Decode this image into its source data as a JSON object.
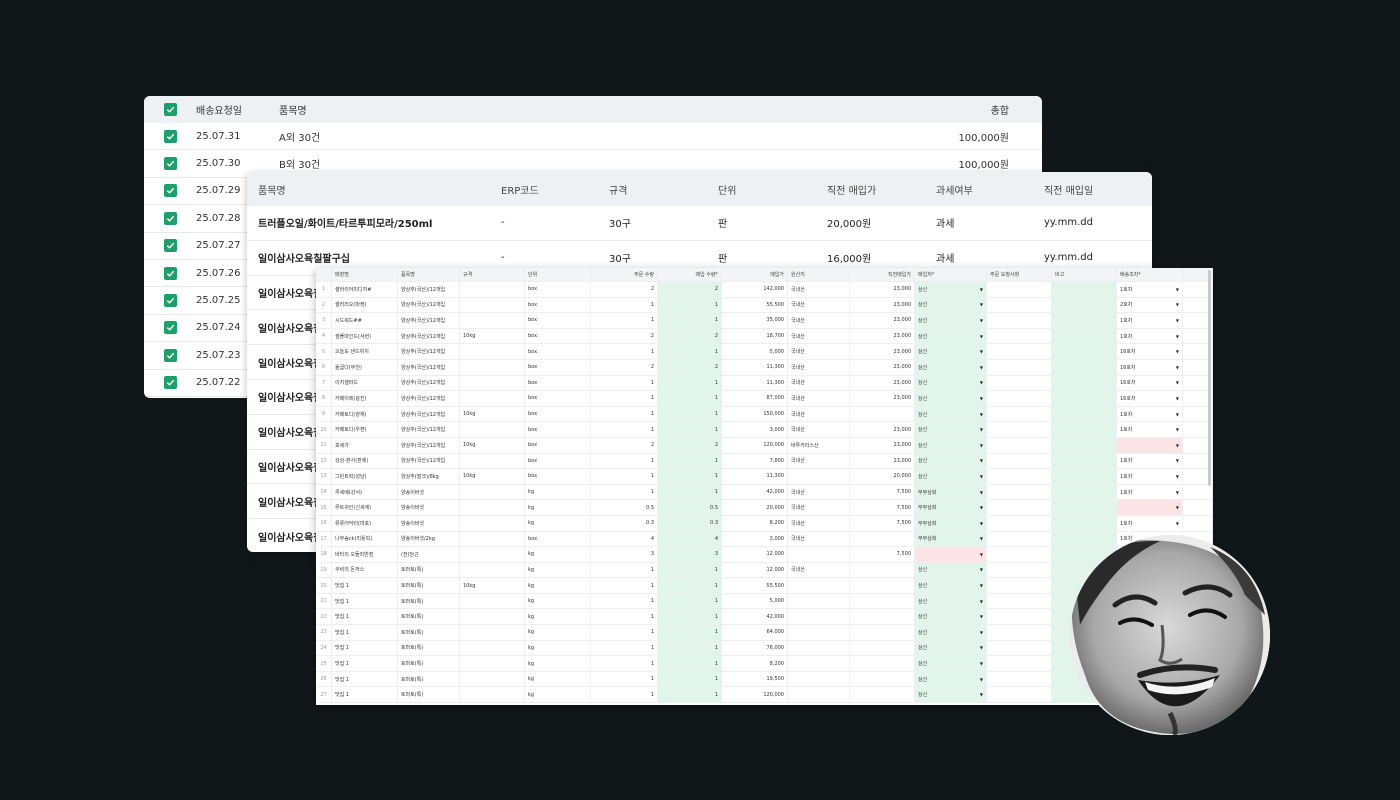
{
  "delivery_list": {
    "headers": {
      "date": "배송요청일",
      "name": "품목명",
      "total": "총합"
    },
    "rows": [
      {
        "date": "25.07.31",
        "name": "A외 30건",
        "total": "100,000원"
      },
      {
        "date": "25.07.30",
        "name": "B외 30건",
        "total": "100,000원"
      },
      {
        "date": "25.07.29",
        "name": "",
        "total": ""
      },
      {
        "date": "25.07.28",
        "name": "",
        "total": ""
      },
      {
        "date": "25.07.27",
        "name": "",
        "total": ""
      },
      {
        "date": "25.07.26",
        "name": "",
        "total": ""
      },
      {
        "date": "25.07.25",
        "name": "",
        "total": ""
      },
      {
        "date": "25.07.24",
        "name": "",
        "total": ""
      },
      {
        "date": "25.07.23",
        "name": "",
        "total": ""
      },
      {
        "date": "25.07.22",
        "name": "",
        "total": ""
      }
    ]
  },
  "item_master": {
    "headers": {
      "name": "품목명",
      "erp": "ERP코드",
      "spec": "규격",
      "unit": "단위",
      "price": "직전 매입가",
      "tax": "과세여부",
      "date": "직전 매입일"
    },
    "rows": [
      {
        "name": "트러플오일/화이트/타르투피모라/250ml",
        "erp": "-",
        "spec": "30구",
        "unit": "판",
        "price": "20,000원",
        "tax": "과세",
        "date": "yy.mm.dd"
      },
      {
        "name": "일이삼사오육칠팔구십",
        "erp": "-",
        "spec": "30구",
        "unit": "판",
        "price": "16,000원",
        "tax": "과세",
        "date": "yy.mm.dd"
      },
      {
        "name": "일이삼사오육칠팔구십",
        "erp": "",
        "spec": "",
        "unit": "",
        "price": "",
        "tax": "",
        "date": ""
      },
      {
        "name": "일이삼사오육칠팔구십",
        "erp": "",
        "spec": "",
        "unit": "",
        "price": "",
        "tax": "",
        "date": ""
      },
      {
        "name": "일이삼사오육칠팔구십",
        "erp": "",
        "spec": "",
        "unit": "",
        "price": "",
        "tax": "",
        "date": ""
      },
      {
        "name": "일이삼사오육칠팔구십",
        "erp": "",
        "spec": "",
        "unit": "",
        "price": "",
        "tax": "",
        "date": ""
      },
      {
        "name": "일이삼사오육칠팔구십",
        "erp": "",
        "spec": "",
        "unit": "",
        "price": "",
        "tax": "",
        "date": ""
      },
      {
        "name": "일이삼사오육칠팔구십",
        "erp": "",
        "spec": "",
        "unit": "",
        "price": "",
        "tax": "",
        "date": ""
      },
      {
        "name": "일이삼사오육칠팔구십",
        "erp": "",
        "spec": "",
        "unit": "",
        "price": "",
        "tax": "",
        "date": ""
      },
      {
        "name": "일이삼사오육칠팔구십",
        "erp": "",
        "spec": "",
        "unit": "",
        "price": "",
        "tax": "",
        "date": ""
      }
    ]
  },
  "order_grid": {
    "headers": [
      "",
      "매장명",
      "품목명",
      "규격",
      "단위",
      "주문 수량",
      "매입 수량*",
      "매입가",
      "원산지",
      "직전매입가",
      "매입처*",
      "주문 요청사항",
      "비고",
      "배송조차*"
    ],
    "rows": [
      [
        "1",
        "셀러리어미디지#",
        "양상추(국산)/12개입",
        "",
        "box",
        "2",
        "2",
        "142,000",
        "국내산",
        "23,000",
        "상신",
        "",
        "",
        "1호차"
      ],
      [
        "2",
        "셀러리오(마켓)",
        "양상추(국산)/12개입",
        "",
        "box",
        "1",
        "1",
        "55,500",
        "국내산",
        "23,000",
        "상신",
        "",
        "",
        "2호차"
      ],
      [
        "3",
        "시드워드##",
        "양상추(국산)/12개입",
        "",
        "box",
        "1",
        "1",
        "35,000",
        "국내산",
        "23,000",
        "상신",
        "",
        "",
        "1호차"
      ],
      [
        "4",
        "샘플마인드(서현)",
        "양상추(국산)/12개입",
        "10kg",
        "box",
        "2",
        "2",
        "18,700",
        "국내산",
        "23,000",
        "상신",
        "",
        "",
        "1호차"
      ],
      [
        "5",
        "오늘도 샌드위치",
        "양상추(국산)/12개입",
        "",
        "box",
        "1",
        "1",
        "5,000",
        "국내산",
        "23,000",
        "상신",
        "",
        "",
        "16호차"
      ],
      [
        "6",
        "울굽다(부천)",
        "양상추(국산)/12개입",
        "",
        "box",
        "2",
        "2",
        "11,300",
        "국내산",
        "23,000",
        "상신",
        "",
        "",
        "16호차"
      ],
      [
        "7",
        "이지샐러드",
        "양상추(국산)/12개입",
        "",
        "box",
        "1",
        "1",
        "11,300",
        "국내산",
        "23,000",
        "상신",
        "",
        "",
        "16호차"
      ],
      [
        "8",
        "카페이레(광진)",
        "양상추(국산)/12개입",
        "",
        "box",
        "1",
        "1",
        "87,000",
        "국내산",
        "23,000",
        "상신",
        "",
        "",
        "16호차"
      ],
      [
        "9",
        "카페토디(양재)",
        "양상추(국산)/12개입",
        "10kg",
        "box",
        "1",
        "1",
        "150,000",
        "국내산",
        "",
        "상신",
        "",
        "",
        "1호차"
      ],
      [
        "10",
        "카페토디(우편)",
        "양상추(국산)/12개입",
        "",
        "box",
        "1",
        "1",
        "3,000",
        "국내산",
        "23,000",
        "상신",
        "",
        "",
        "1호차"
      ],
      [
        "11",
        "포세가",
        "양상추(국산)/12개입",
        "10kg",
        "box",
        "2",
        "2",
        "120,000",
        "바투카라스산",
        "23,000",
        "상신",
        "",
        "",
        ""
      ],
      [
        "12",
        "성심-본사(판제)",
        "양상추(국산)/12개입",
        "",
        "box",
        "1",
        "1",
        "7,800",
        "국내산",
        "23,000",
        "상신",
        "",
        "",
        "1호차"
      ],
      [
        "13",
        "그린트럭(성남)",
        "양상추(벌크)/8kg",
        "10kg",
        "box",
        "1",
        "1",
        "11,300",
        "",
        "20,000",
        "상신",
        "",
        "",
        "1호차"
      ],
      [
        "14",
        "루세베(강서)",
        "양송이버섯",
        "",
        "kg",
        "1",
        "1",
        "42,000",
        "국내산",
        "7,500",
        "무무상회",
        "",
        "",
        "1호차"
      ],
      [
        "15",
        "루트귀인(신세계)",
        "양송이버섯",
        "",
        "kg",
        "0.5",
        "0.5",
        "20,000",
        "국내산",
        "7,500",
        "무무상회",
        "",
        "",
        ""
      ],
      [
        "16",
        "류류어딕터(마포)",
        "양송이버섯",
        "",
        "kg",
        "0.3",
        "0.3",
        "8,200",
        "국내산",
        "7,500",
        "무무상회",
        "",
        "",
        "1호차"
      ],
      [
        "17",
        "나무숲ck(리틀빅)",
        "양송이버섯/2kg",
        "",
        "box",
        "4",
        "4",
        "3,000",
        "국내산",
        "",
        "무무상회",
        "",
        "",
        "1호차"
      ],
      [
        "18",
        "바타의 오들러반점",
        "(전)당근",
        "",
        "kg",
        "3",
        "3",
        "12,000",
        "",
        "7,500",
        "",
        "",
        "",
        ""
      ],
      [
        "19",
        "쿠비의 돈까스",
        "토마토(특)",
        "",
        "kg",
        "1",
        "1",
        "12,000",
        "국내산",
        "",
        "상신",
        "",
        "",
        ""
      ],
      [
        "20",
        "맛집 1",
        "토마토(특)",
        "10kg",
        "kg",
        "1",
        "1",
        "55,500",
        "",
        "",
        "상신",
        "",
        "",
        ""
      ],
      [
        "21",
        "맛집 1",
        "토마토(특)",
        "",
        "kg",
        "1",
        "1",
        "5,000",
        "",
        "",
        "상신",
        "",
        "",
        ""
      ],
      [
        "22",
        "맛집 1",
        "토마토(특)",
        "",
        "kg",
        "1",
        "1",
        "42,000",
        "",
        "",
        "상신",
        "",
        "",
        ""
      ],
      [
        "23",
        "맛집 1",
        "토마토(특)",
        "",
        "kg",
        "1",
        "1",
        "64,000",
        "",
        "",
        "상신",
        "",
        "",
        ""
      ],
      [
        "24",
        "맛집 1",
        "토마토(특)",
        "",
        "kg",
        "1",
        "1",
        "76,000",
        "",
        "",
        "상신",
        "",
        "",
        ""
      ],
      [
        "25",
        "맛집 1",
        "토마토(특)",
        "",
        "kg",
        "1",
        "1",
        "8,200",
        "",
        "",
        "상신",
        "",
        "",
        ""
      ],
      [
        "26",
        "맛집 1",
        "토마토(특)",
        "",
        "kg",
        "1",
        "1",
        "19,500",
        "",
        "",
        "상신",
        "",
        "",
        ""
      ],
      [
        "27",
        "맛집 1",
        "토마토(특)",
        "",
        "kg",
        "1",
        "1",
        "120,000",
        "",
        "",
        "상신",
        "",
        "",
        ""
      ]
    ],
    "error_rows": {
      "vendor": [
        "18"
      ],
      "truck": [
        "11",
        "15"
      ]
    },
    "colors": {
      "editable_cell": "#e2f5ea",
      "error_cell": "#fbe3e6",
      "checkbox": "#1d9f6c"
    },
    "caret_icon": "▼"
  }
}
